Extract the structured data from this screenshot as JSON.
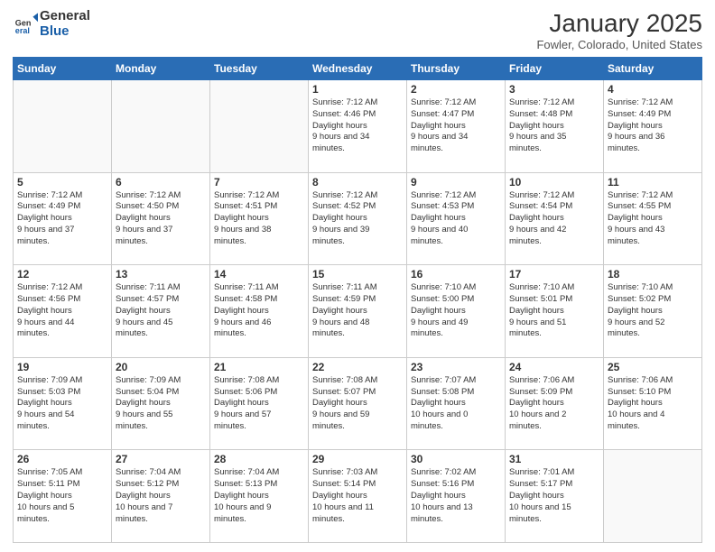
{
  "logo": {
    "general": "General",
    "blue": "Blue"
  },
  "header": {
    "month": "January 2025",
    "location": "Fowler, Colorado, United States"
  },
  "weekdays": [
    "Sunday",
    "Monday",
    "Tuesday",
    "Wednesday",
    "Thursday",
    "Friday",
    "Saturday"
  ],
  "weeks": [
    [
      {
        "day": "",
        "empty": true
      },
      {
        "day": "",
        "empty": true
      },
      {
        "day": "",
        "empty": true
      },
      {
        "day": "1",
        "sunrise": "7:12 AM",
        "sunset": "4:46 PM",
        "daylight": "9 hours and 34 minutes."
      },
      {
        "day": "2",
        "sunrise": "7:12 AM",
        "sunset": "4:47 PM",
        "daylight": "9 hours and 34 minutes."
      },
      {
        "day": "3",
        "sunrise": "7:12 AM",
        "sunset": "4:48 PM",
        "daylight": "9 hours and 35 minutes."
      },
      {
        "day": "4",
        "sunrise": "7:12 AM",
        "sunset": "4:49 PM",
        "daylight": "9 hours and 36 minutes."
      }
    ],
    [
      {
        "day": "5",
        "sunrise": "7:12 AM",
        "sunset": "4:49 PM",
        "daylight": "9 hours and 37 minutes."
      },
      {
        "day": "6",
        "sunrise": "7:12 AM",
        "sunset": "4:50 PM",
        "daylight": "9 hours and 37 minutes."
      },
      {
        "day": "7",
        "sunrise": "7:12 AM",
        "sunset": "4:51 PM",
        "daylight": "9 hours and 38 minutes."
      },
      {
        "day": "8",
        "sunrise": "7:12 AM",
        "sunset": "4:52 PM",
        "daylight": "9 hours and 39 minutes."
      },
      {
        "day": "9",
        "sunrise": "7:12 AM",
        "sunset": "4:53 PM",
        "daylight": "9 hours and 40 minutes."
      },
      {
        "day": "10",
        "sunrise": "7:12 AM",
        "sunset": "4:54 PM",
        "daylight": "9 hours and 42 minutes."
      },
      {
        "day": "11",
        "sunrise": "7:12 AM",
        "sunset": "4:55 PM",
        "daylight": "9 hours and 43 minutes."
      }
    ],
    [
      {
        "day": "12",
        "sunrise": "7:12 AM",
        "sunset": "4:56 PM",
        "daylight": "9 hours and 44 minutes."
      },
      {
        "day": "13",
        "sunrise": "7:11 AM",
        "sunset": "4:57 PM",
        "daylight": "9 hours and 45 minutes."
      },
      {
        "day": "14",
        "sunrise": "7:11 AM",
        "sunset": "4:58 PM",
        "daylight": "9 hours and 46 minutes."
      },
      {
        "day": "15",
        "sunrise": "7:11 AM",
        "sunset": "4:59 PM",
        "daylight": "9 hours and 48 minutes."
      },
      {
        "day": "16",
        "sunrise": "7:10 AM",
        "sunset": "5:00 PM",
        "daylight": "9 hours and 49 minutes."
      },
      {
        "day": "17",
        "sunrise": "7:10 AM",
        "sunset": "5:01 PM",
        "daylight": "9 hours and 51 minutes."
      },
      {
        "day": "18",
        "sunrise": "7:10 AM",
        "sunset": "5:02 PM",
        "daylight": "9 hours and 52 minutes."
      }
    ],
    [
      {
        "day": "19",
        "sunrise": "7:09 AM",
        "sunset": "5:03 PM",
        "daylight": "9 hours and 54 minutes."
      },
      {
        "day": "20",
        "sunrise": "7:09 AM",
        "sunset": "5:04 PM",
        "daylight": "9 hours and 55 minutes."
      },
      {
        "day": "21",
        "sunrise": "7:08 AM",
        "sunset": "5:06 PM",
        "daylight": "9 hours and 57 minutes."
      },
      {
        "day": "22",
        "sunrise": "7:08 AM",
        "sunset": "5:07 PM",
        "daylight": "9 hours and 59 minutes."
      },
      {
        "day": "23",
        "sunrise": "7:07 AM",
        "sunset": "5:08 PM",
        "daylight": "10 hours and 0 minutes."
      },
      {
        "day": "24",
        "sunrise": "7:06 AM",
        "sunset": "5:09 PM",
        "daylight": "10 hours and 2 minutes."
      },
      {
        "day": "25",
        "sunrise": "7:06 AM",
        "sunset": "5:10 PM",
        "daylight": "10 hours and 4 minutes."
      }
    ],
    [
      {
        "day": "26",
        "sunrise": "7:05 AM",
        "sunset": "5:11 PM",
        "daylight": "10 hours and 5 minutes."
      },
      {
        "day": "27",
        "sunrise": "7:04 AM",
        "sunset": "5:12 PM",
        "daylight": "10 hours and 7 minutes."
      },
      {
        "day": "28",
        "sunrise": "7:04 AM",
        "sunset": "5:13 PM",
        "daylight": "10 hours and 9 minutes."
      },
      {
        "day": "29",
        "sunrise": "7:03 AM",
        "sunset": "5:14 PM",
        "daylight": "10 hours and 11 minutes."
      },
      {
        "day": "30",
        "sunrise": "7:02 AM",
        "sunset": "5:16 PM",
        "daylight": "10 hours and 13 minutes."
      },
      {
        "day": "31",
        "sunrise": "7:01 AM",
        "sunset": "5:17 PM",
        "daylight": "10 hours and 15 minutes."
      },
      {
        "day": "",
        "empty": true
      }
    ]
  ]
}
